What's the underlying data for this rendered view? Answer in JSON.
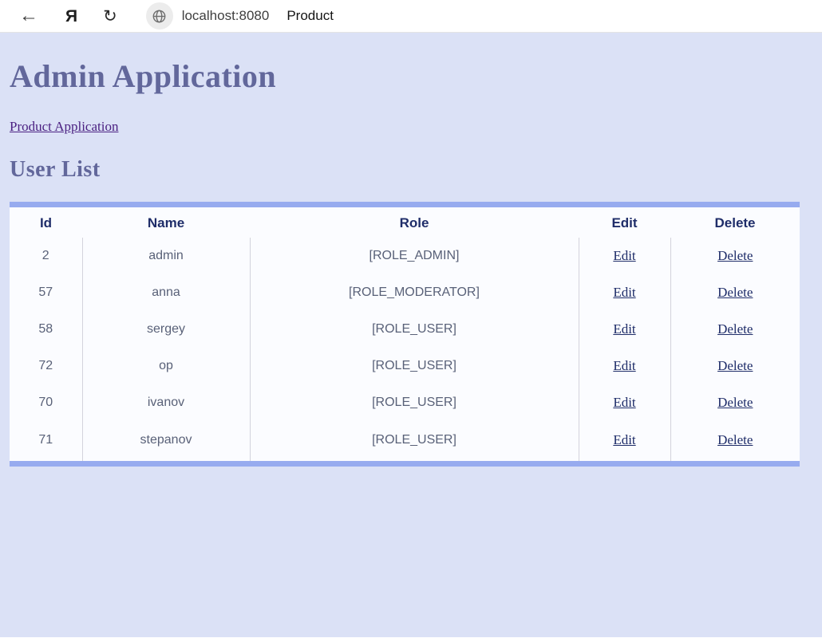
{
  "browser": {
    "back_icon": "←",
    "yandex_icon": "Я",
    "refresh_icon": "↻",
    "url": "localhost:8080",
    "page_title": "Product"
  },
  "page": {
    "title": "Admin Application",
    "nav_link_label": "Product Application",
    "section_title": "User List"
  },
  "table": {
    "headers": [
      "Id",
      "Name",
      "Role",
      "Edit",
      "Delete"
    ],
    "rows": [
      {
        "id": "2",
        "name": "admin",
        "role": "[ROLE_ADMIN]",
        "edit": "Edit",
        "delete": "Delete"
      },
      {
        "id": "57",
        "name": "anna",
        "role": "[ROLE_MODERATOR]",
        "edit": "Edit",
        "delete": "Delete"
      },
      {
        "id": "58",
        "name": "sergey",
        "role": "[ROLE_USER]",
        "edit": "Edit",
        "delete": "Delete"
      },
      {
        "id": "72",
        "name": "op",
        "role": "[ROLE_USER]",
        "edit": "Edit",
        "delete": "Delete"
      },
      {
        "id": "70",
        "name": "ivanov",
        "role": "[ROLE_USER]",
        "edit": "Edit",
        "delete": "Delete"
      },
      {
        "id": "71",
        "name": "stepanov",
        "role": "[ROLE_USER]",
        "edit": "Edit",
        "delete": "Delete"
      }
    ]
  },
  "colors": {
    "page_background": "#dbe1f6",
    "heading": "#62679b",
    "nav_link": "#4b2182",
    "table_background": "#fbfcff",
    "table_accent_bar": "#97abef",
    "table_header_text": "#1f2d69",
    "cell_text": "#596178",
    "row_link": "#1f2d69",
    "column_divider": "#d3d3dc"
  }
}
